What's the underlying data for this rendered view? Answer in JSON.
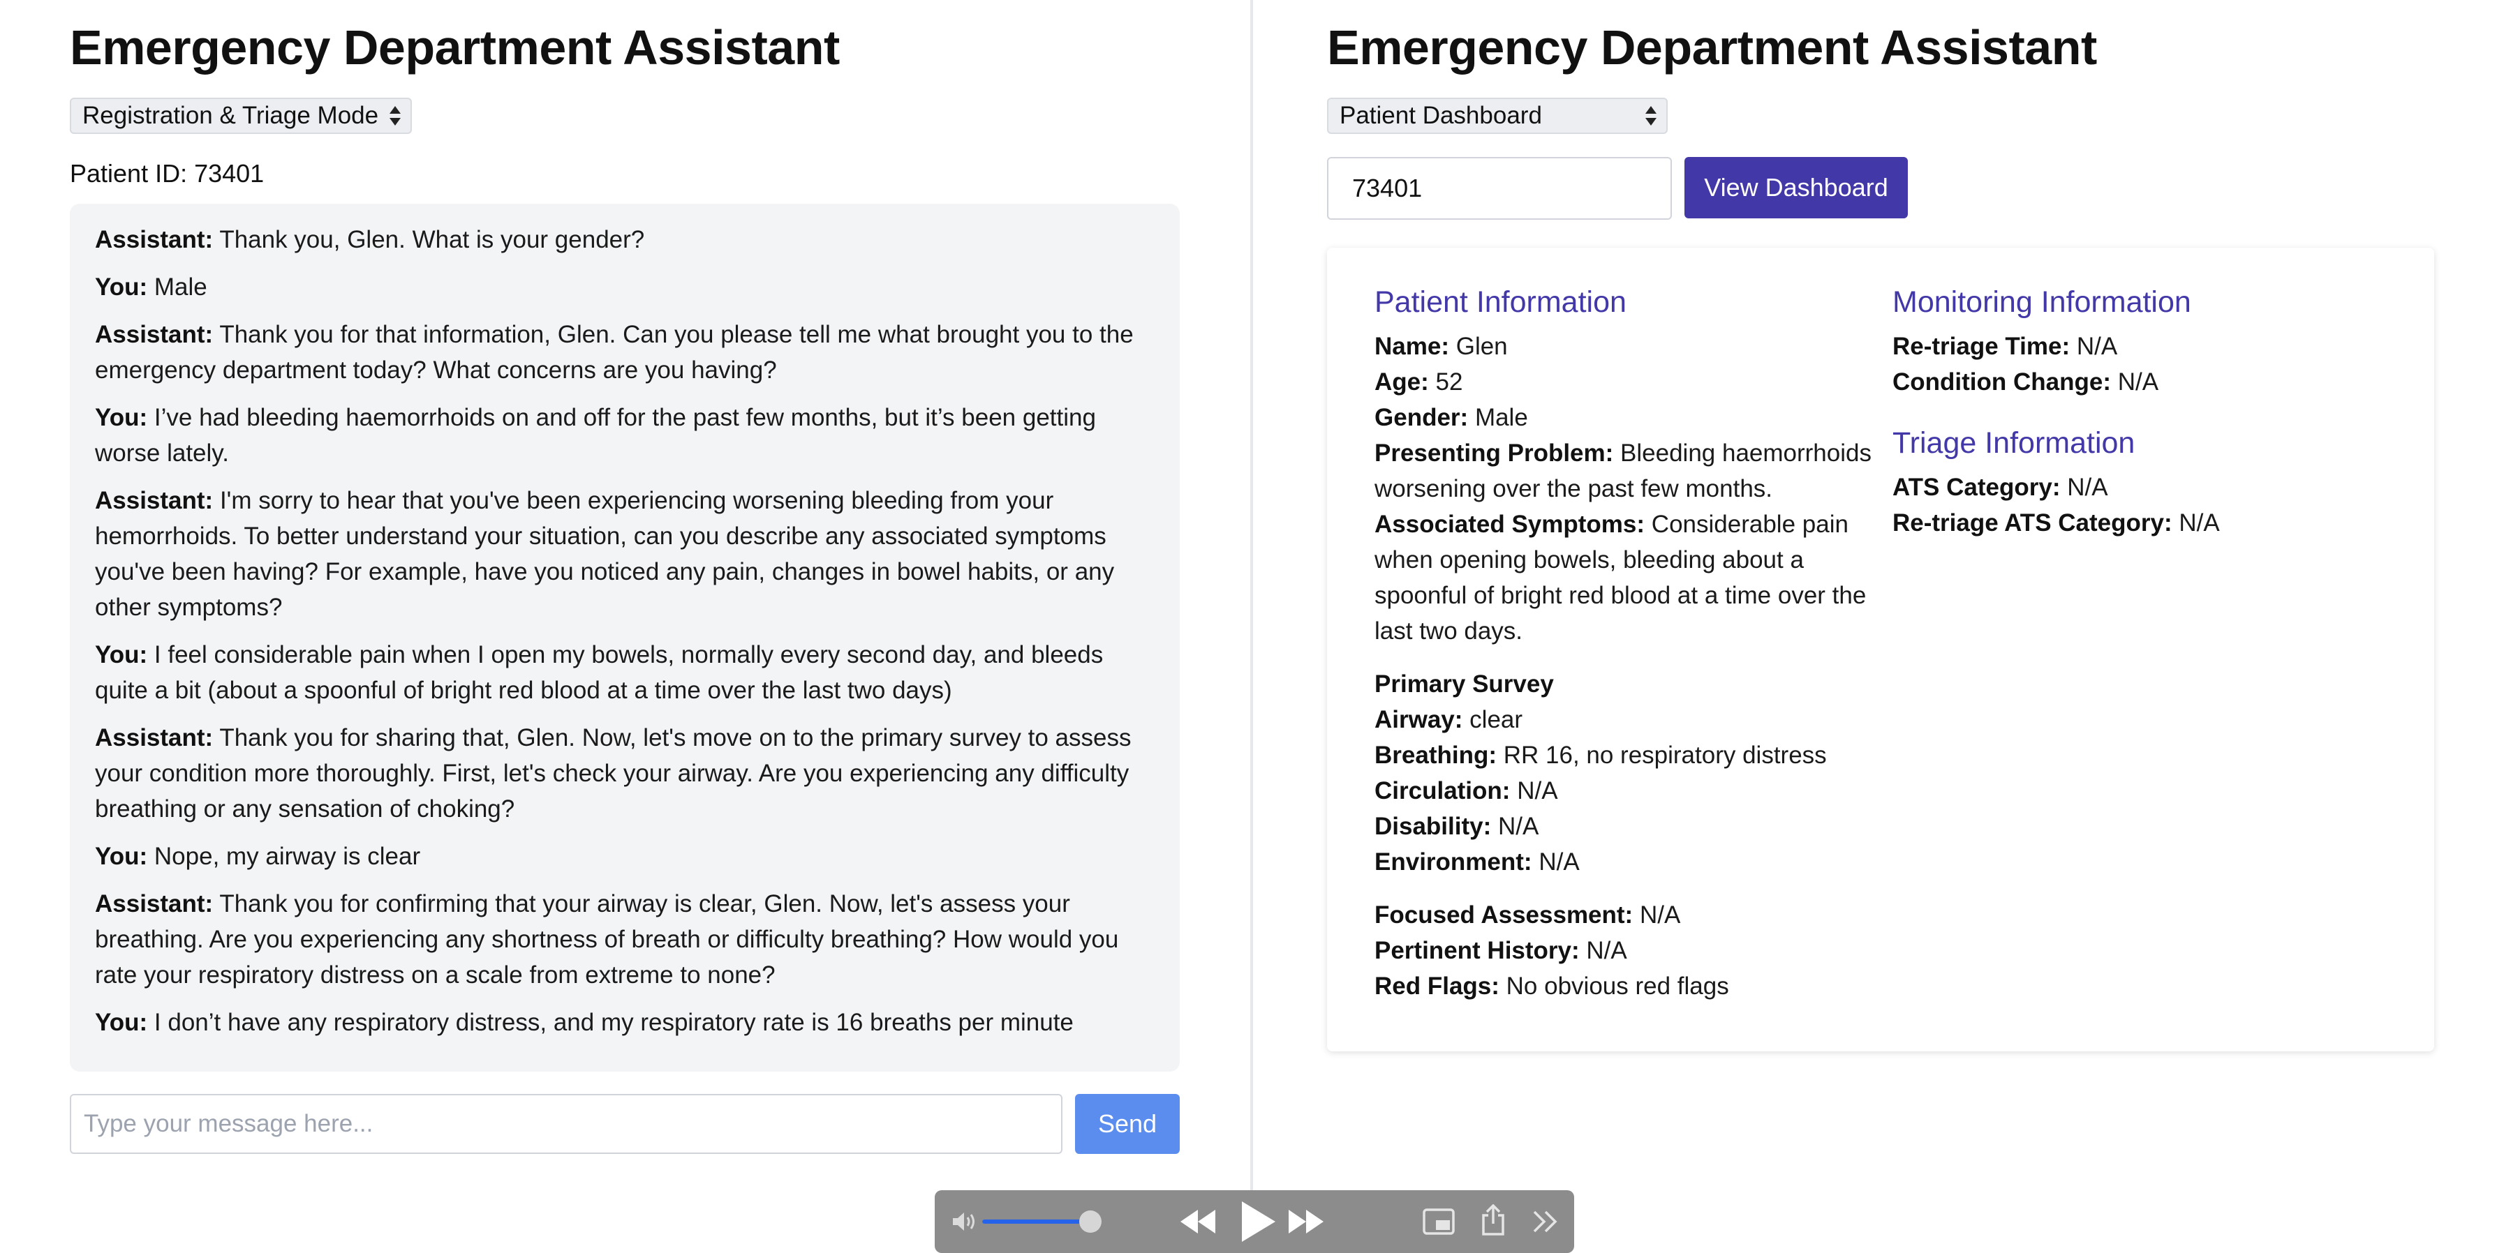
{
  "left_panel": {
    "title": "Emergency Department Assistant",
    "mode_select": "Registration & Triage Mode",
    "patient_id_label": "Patient ID: 73401",
    "messages": [
      {
        "speaker": "Assistant:",
        "text": "Thank you, Glen. What is your gender?"
      },
      {
        "speaker": "You:",
        "text": "Male"
      },
      {
        "speaker": "Assistant:",
        "text": "Thank you for that information, Glen. Can you please tell me what brought you to the emergency department today? What concerns are you having?"
      },
      {
        "speaker": "You:",
        "text": "I’ve had bleeding haemorrhoids on and off for the past few months, but it’s been getting worse lately."
      },
      {
        "speaker": "Assistant:",
        "text": "I'm sorry to hear that you've been experiencing worsening bleeding from your hemorrhoids. To better understand your situation, can you describe any associated symptoms you've been having? For example, have you noticed any pain, changes in bowel habits, or any other symptoms?"
      },
      {
        "speaker": "You:",
        "text": "I feel considerable pain when I open my bowels, normally every second day, and bleeds quite a bit (about a spoonful of bright red blood at a time over the last two days)"
      },
      {
        "speaker": "Assistant:",
        "text": "Thank you for sharing that, Glen. Now, let's move on to the primary survey to assess your condition more thoroughly. First, let's check your airway. Are you experiencing any difficulty breathing or any sensation of choking?"
      },
      {
        "speaker": "You:",
        "text": "Nope, my airway is clear"
      },
      {
        "speaker": "Assistant:",
        "text": "Thank you for confirming that your airway is clear, Glen. Now, let's assess your breathing. Are you experiencing any shortness of breath or difficulty breathing? How would you rate your respiratory distress on a scale from extreme to none?"
      },
      {
        "speaker": "You:",
        "text": "I don’t have any respiratory distress, and my respiratory rate is 16 breaths per minute"
      }
    ],
    "input_placeholder": "Type your message here...",
    "send_label": "Send"
  },
  "right_panel": {
    "title": "Emergency Department Assistant",
    "mode_select": "Patient Dashboard",
    "patient_id_value": "73401",
    "view_button": "View Dashboard",
    "patient_info": {
      "title": "Patient Information",
      "name": {
        "label": "Name:",
        "value": "Glen"
      },
      "age": {
        "label": "Age:",
        "value": "52"
      },
      "gender": {
        "label": "Gender:",
        "value": "Male"
      },
      "presenting_problem": {
        "label": "Presenting Problem:",
        "value": "Bleeding haemorrhoids worsening over the past few months."
      },
      "associated_symptoms": {
        "label": "Associated Symptoms:",
        "value": "Considerable pain when opening bowels, bleeding about a spoonful of bright red blood at a time over the last two days."
      }
    },
    "primary_survey": {
      "title": "Primary Survey",
      "airway": {
        "label": "Airway:",
        "value": "clear"
      },
      "breathing": {
        "label": "Breathing:",
        "value": "RR 16, no respiratory distress"
      },
      "circulation": {
        "label": "Circulation:",
        "value": "N/A"
      },
      "disability": {
        "label": "Disability:",
        "value": "N/A"
      },
      "environment": {
        "label": "Environment:",
        "value": "N/A"
      }
    },
    "assessment": {
      "focused_assessment": {
        "label": "Focused Assessment:",
        "value": "N/A"
      },
      "pertinent_history": {
        "label": "Pertinent History:",
        "value": "N/A"
      },
      "red_flags": {
        "label": "Red Flags:",
        "value": "No obvious red flags"
      }
    },
    "monitoring_info": {
      "title": "Monitoring Information",
      "retriage_time": {
        "label": "Re-triage Time:",
        "value": "N/A"
      },
      "condition_change": {
        "label": "Condition Change:",
        "value": "N/A"
      }
    },
    "triage_info": {
      "title": "Triage Information",
      "ats_category": {
        "label": "ATS Category:",
        "value": "N/A"
      },
      "retriage_ats_category": {
        "label": "Re-triage ATS Category:",
        "value": "N/A"
      }
    }
  },
  "media_controls": {
    "volume_level": 0.97,
    "icons": [
      "volume-icon",
      "rewind-icon",
      "play-icon",
      "fast-forward-icon",
      "picture-in-picture-icon",
      "share-icon",
      "more-icon"
    ]
  },
  "colors": {
    "accent_purple": "#4338a8",
    "send_blue": "#5b8def",
    "chat_bg": "#f3f4f6",
    "volume_blue": "#2563eb"
  }
}
